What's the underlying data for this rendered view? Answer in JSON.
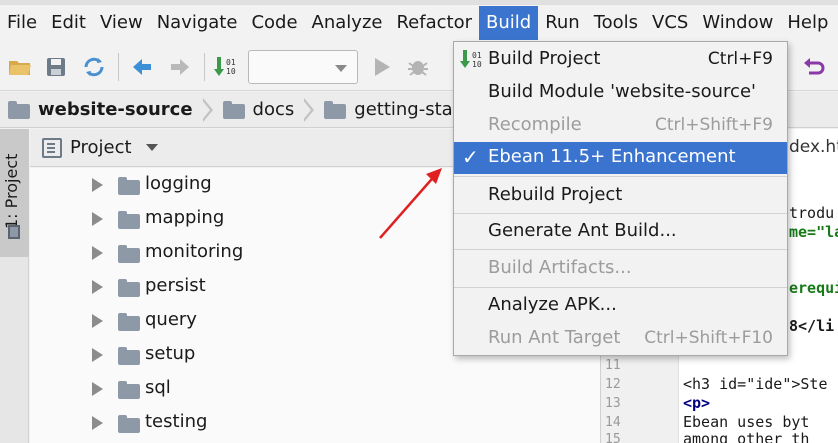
{
  "menubar": {
    "items": [
      {
        "label": "File",
        "active": false
      },
      {
        "label": "Edit",
        "active": false
      },
      {
        "label": "View",
        "active": false
      },
      {
        "label": "Navigate",
        "active": false
      },
      {
        "label": "Code",
        "active": false
      },
      {
        "label": "Analyze",
        "active": false
      },
      {
        "label": "Refactor",
        "active": false
      },
      {
        "label": "Build",
        "active": true
      },
      {
        "label": "Run",
        "active": false
      },
      {
        "label": "Tools",
        "active": false
      },
      {
        "label": "VCS",
        "active": false
      },
      {
        "label": "Window",
        "active": false
      },
      {
        "label": "Help",
        "active": false
      }
    ]
  },
  "breadcrumb": {
    "project": "website-source",
    "folder1": "docs",
    "folder2": "getting-started"
  },
  "left_strip": {
    "tab_label": "1: Project"
  },
  "project_panel": {
    "title": "Project",
    "folders": [
      "logging",
      "mapping",
      "monitoring",
      "persist",
      "query",
      "setup",
      "sql",
      "testing"
    ]
  },
  "editor": {
    "tab_fragment": "dex.ht",
    "lines": [
      {
        "num": "",
        "text": "trodu"
      },
      {
        "num": "",
        "text": "me=\"la"
      },
      {
        "num": "",
        "text": "erequi"
      },
      {
        "num": "",
        "text": "8</li"
      },
      {
        "num": "11",
        "text": ""
      },
      {
        "num": "12",
        "text": "<h3 id=\"ide\">Ste"
      },
      {
        "num": "13",
        "text": "<p>"
      },
      {
        "num": "14",
        "text": "  Ebean uses byt"
      },
      {
        "num": "15",
        "text": "  among other th"
      }
    ]
  },
  "build_menu": {
    "items": [
      {
        "label": "Build Project",
        "shortcut": "Ctrl+F9",
        "disabled": false,
        "selected": false,
        "icon": "build-project-icon"
      },
      {
        "label": "Build Module 'website-source'",
        "shortcut": "",
        "disabled": false,
        "selected": false
      },
      {
        "label": "Recompile",
        "shortcut": "Ctrl+Shift+F9",
        "disabled": true,
        "selected": false
      },
      {
        "label": "Ebean 11.5+ Enhancement",
        "shortcut": "",
        "disabled": false,
        "selected": true,
        "checked": true
      },
      {
        "label": "Rebuild Project",
        "shortcut": "",
        "disabled": false,
        "selected": false
      },
      {
        "label": "Generate Ant Build...",
        "shortcut": "",
        "disabled": false,
        "selected": false
      },
      {
        "label": "Build Artifacts...",
        "shortcut": "",
        "disabled": true,
        "selected": false
      },
      {
        "label": "Analyze APK...",
        "shortcut": "",
        "disabled": false,
        "selected": false
      },
      {
        "label": "Run Ant Target",
        "shortcut": "Ctrl+Shift+F10",
        "disabled": true,
        "selected": false
      }
    ],
    "checkmark": "✓"
  },
  "colors": {
    "accent": "#3b74cf",
    "annotation": "#e02020",
    "folder": "#8d99a6"
  }
}
